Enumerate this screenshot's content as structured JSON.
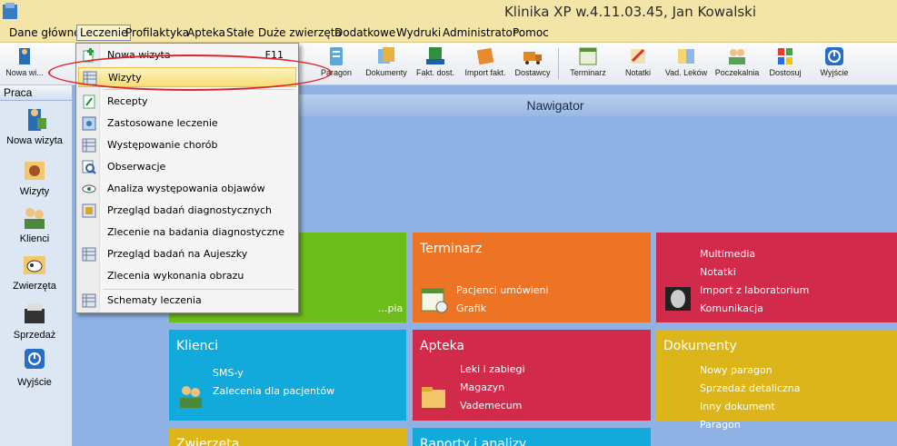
{
  "window": {
    "title": "Klinika XP w.4.11.03.45, Jan Kowalski"
  },
  "menubar": {
    "items": [
      "Dane główne",
      "Leczenie",
      "Profilaktyka",
      "Apteka",
      "Stałe",
      "Duże zwierzęta",
      "Dodatkowe",
      "Wydruki",
      "Administrator",
      "Pomoc"
    ],
    "active": "Leczenie"
  },
  "toolbar": {
    "items": [
      "Nowa wi...",
      "Paragon",
      "Dokumenty",
      "Fakt. dost.",
      "Import fakt.",
      "Dostawcy",
      "Terminarz",
      "Notatki",
      "Vad. Leków",
      "Poczekalnia",
      "Dostosuj",
      "Wyjście"
    ]
  },
  "left_panel": {
    "header": "Praca",
    "items": [
      "Nowa wizyta",
      "Wizyty",
      "Klienci",
      "Zwierzęta",
      "Sprzedaż",
      "Wyjście"
    ]
  },
  "navigator": {
    "title": "Nawigator"
  },
  "tiles": {
    "green": {
      "items": [
        "...pia"
      ]
    },
    "terminarz": {
      "title": "Terminarz",
      "items": [
        "Pacjenci umówieni",
        "Grafik"
      ]
    },
    "red_top": {
      "items": [
        "Multimedia",
        "Notatki",
        "Import z laboratorium",
        "Komunikacja"
      ]
    },
    "klienci": {
      "title": "Klienci",
      "items": [
        "SMS-y",
        "Zalecenia dla pacjentów"
      ]
    },
    "apteka": {
      "title": "Apteka",
      "items": [
        "Leki i zabiegi",
        "Magazyn",
        "Vademecum"
      ]
    },
    "dokumenty": {
      "title": "Dokumenty",
      "items": [
        "Nowy paragon",
        "Sprzedaż detaliczna",
        "Inny dokument",
        "Paragon"
      ]
    },
    "zwierzeta": {
      "title": "Zwierzęta"
    },
    "raporty": {
      "title": "Raporty i analizy"
    }
  },
  "dropdown": {
    "items": [
      {
        "label": "Nowa wizyta",
        "shortcut": "F11"
      },
      {
        "label": "Wizyty",
        "shortcut": ""
      },
      {
        "label": "Recepty",
        "shortcut": ""
      },
      {
        "label": "Zastosowane leczenie",
        "shortcut": ""
      },
      {
        "label": "Występowanie chorób",
        "shortcut": ""
      },
      {
        "label": "Obserwacje",
        "shortcut": ""
      },
      {
        "label": "Analiza występowania objawów",
        "shortcut": ""
      },
      {
        "label": "Przegląd badań diagnostycznych",
        "shortcut": ""
      },
      {
        "label": "Zlecenie na badania diagnostyczne",
        "shortcut": ""
      },
      {
        "label": "Przegląd badań na Aujeszky",
        "shortcut": ""
      },
      {
        "label": "Zlecenia wykonania obrazu",
        "shortcut": ""
      },
      {
        "label": "Schematy leczenia",
        "shortcut": ""
      }
    ],
    "highlighted": "Wizyty"
  },
  "colors": {
    "green": "#6cbd1c",
    "orange": "#ec7424",
    "crimson": "#d22a4b",
    "cyan": "#12aadb",
    "gold": "#dcb51a",
    "annotation": "#d8282b"
  }
}
